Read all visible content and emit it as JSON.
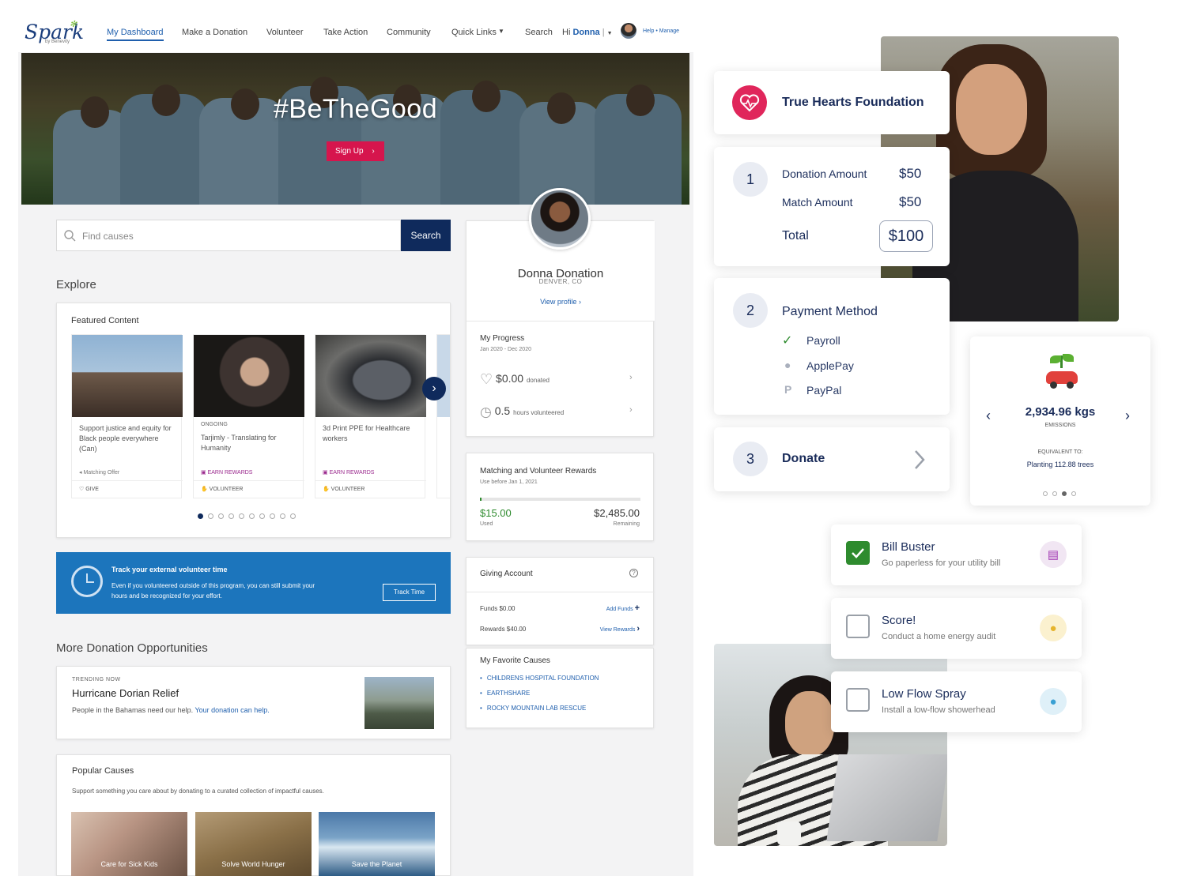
{
  "brand": {
    "logo": "Spark",
    "byline": "by Benevity"
  },
  "nav": {
    "items": [
      "My Dashboard",
      "Make a Donation",
      "Volunteer",
      "Take Action",
      "Community",
      "Quick Links",
      "Search"
    ],
    "greeting": "Hi",
    "user": "Donna",
    "help": "Help • Manage"
  },
  "hero": {
    "tagline": "#BeTheGood",
    "signup": "Sign Up"
  },
  "search": {
    "placeholder": "Find causes",
    "button": "Search"
  },
  "explore": {
    "title": "Explore",
    "featured_title": "Featured Content",
    "cards": [
      {
        "title": "Support justice and equity for Black people everywhere (Can)",
        "tag": "",
        "meta": "Matching Offer",
        "action": "GIVE"
      },
      {
        "title": "Tarjimly - Translating for Humanity",
        "tag": "ONGOING",
        "meta": "EARN REWARDS",
        "action": "VOLUNTEER"
      },
      {
        "title": "3d Print PPE for Healthcare workers",
        "tag": "",
        "meta": "EARN REWARDS",
        "action": "VOLUNTEER"
      }
    ]
  },
  "track": {
    "title": "Track your external volunteer time",
    "desc": "Even if you volunteered outside of this program, you can still submit your hours and be recognized for your effort.",
    "button": "Track Time"
  },
  "more": {
    "title": "More Donation Opportunities",
    "trending_label": "TRENDING NOW",
    "trending_title": "Hurricane Dorian Relief",
    "trending_text": "People in the Bahamas need our help.",
    "trending_link": "Your donation can help."
  },
  "popular": {
    "title": "Popular Causes",
    "desc": "Support something you care about by donating to a curated collection of impactful causes.",
    "items": [
      "Care for Sick Kids",
      "Solve World Hunger",
      "Save the Planet"
    ]
  },
  "profile": {
    "name": "Donna Donation",
    "location": "DENVER, CO",
    "view": "View profile"
  },
  "progress": {
    "title": "My Progress",
    "range": "Jan 2020 - Dec 2020",
    "donated": "$0.00",
    "donated_label": "donated",
    "hours": "0.5",
    "hours_label": "hours volunteered"
  },
  "rewards": {
    "title": "Matching and Volunteer Rewards",
    "sub": "Use before Jan 1, 2021",
    "used": "$15.00",
    "used_label": "Used",
    "remaining": "$2,485.00",
    "remaining_label": "Remaining",
    "progress_fraction": 0.006
  },
  "giving": {
    "title": "Giving Account",
    "funds": "Funds $0.00",
    "add": "Add Funds",
    "rewards": "Rewards $40.00",
    "view": "View Rewards"
  },
  "favorites": {
    "title": "My Favorite Causes",
    "items": [
      "CHILDRENS HOSPITAL FOUNDATION",
      "EARTHSHARE",
      "ROCKY MOUNTAIN LAB RESCUE"
    ]
  },
  "donation": {
    "org": "True Hearts Foundation",
    "step1": "1",
    "amount_label": "Donation Amount",
    "amount": "$50",
    "match_label": "Match Amount",
    "match": "$50",
    "total_label": "Total",
    "total": "$100",
    "step2": "2",
    "payment_title": "Payment Method",
    "methods": [
      "Payroll",
      "ApplePay",
      "PayPal"
    ],
    "step3": "3",
    "donate": "Donate"
  },
  "emissions": {
    "value": "2,934.96 kgs",
    "label": "EMISSIONS",
    "equiv": "EQUIVALENT TO:",
    "trees": "Planting 112.88 trees"
  },
  "tasks": [
    {
      "title": "Bill Buster",
      "sub": "Go paperless for your utility bill",
      "checked": true
    },
    {
      "title": "Score!",
      "sub": "Conduct a home energy audit",
      "checked": false
    },
    {
      "title": "Low Flow Spray",
      "sub": "Install a low-flow showerhead",
      "checked": false
    }
  ],
  "colors": {
    "brand_navy": "#0f2a5c",
    "accent_pink": "#d6154d",
    "track_blue": "#1c75bc",
    "success_green": "#2e8b2e"
  }
}
